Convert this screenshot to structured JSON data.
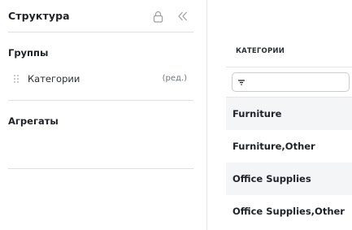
{
  "panel": {
    "title": "Структура",
    "groups_title": "Группы",
    "group_item": {
      "label": "Категории",
      "edit": "(ред.)"
    },
    "aggregates_title": "Агрегаты"
  },
  "table": {
    "column_header": "КАТЕГОРИИ",
    "filter": {
      "value": "",
      "placeholder": ""
    },
    "rows": [
      {
        "label": "Furniture"
      },
      {
        "label": "Furniture,Other"
      },
      {
        "label": "Office Supplies"
      },
      {
        "label": "Office Supplies,Other"
      }
    ]
  },
  "icons": {
    "lock": "lock-icon",
    "collapse": "collapse-left-icon",
    "drag": "drag-handle-icon",
    "filter": "filter-icon"
  },
  "colors": {
    "row_alt_bg": "#f4f5f7",
    "divider": "#dcdfe4",
    "icon": "#9aa0a8"
  }
}
